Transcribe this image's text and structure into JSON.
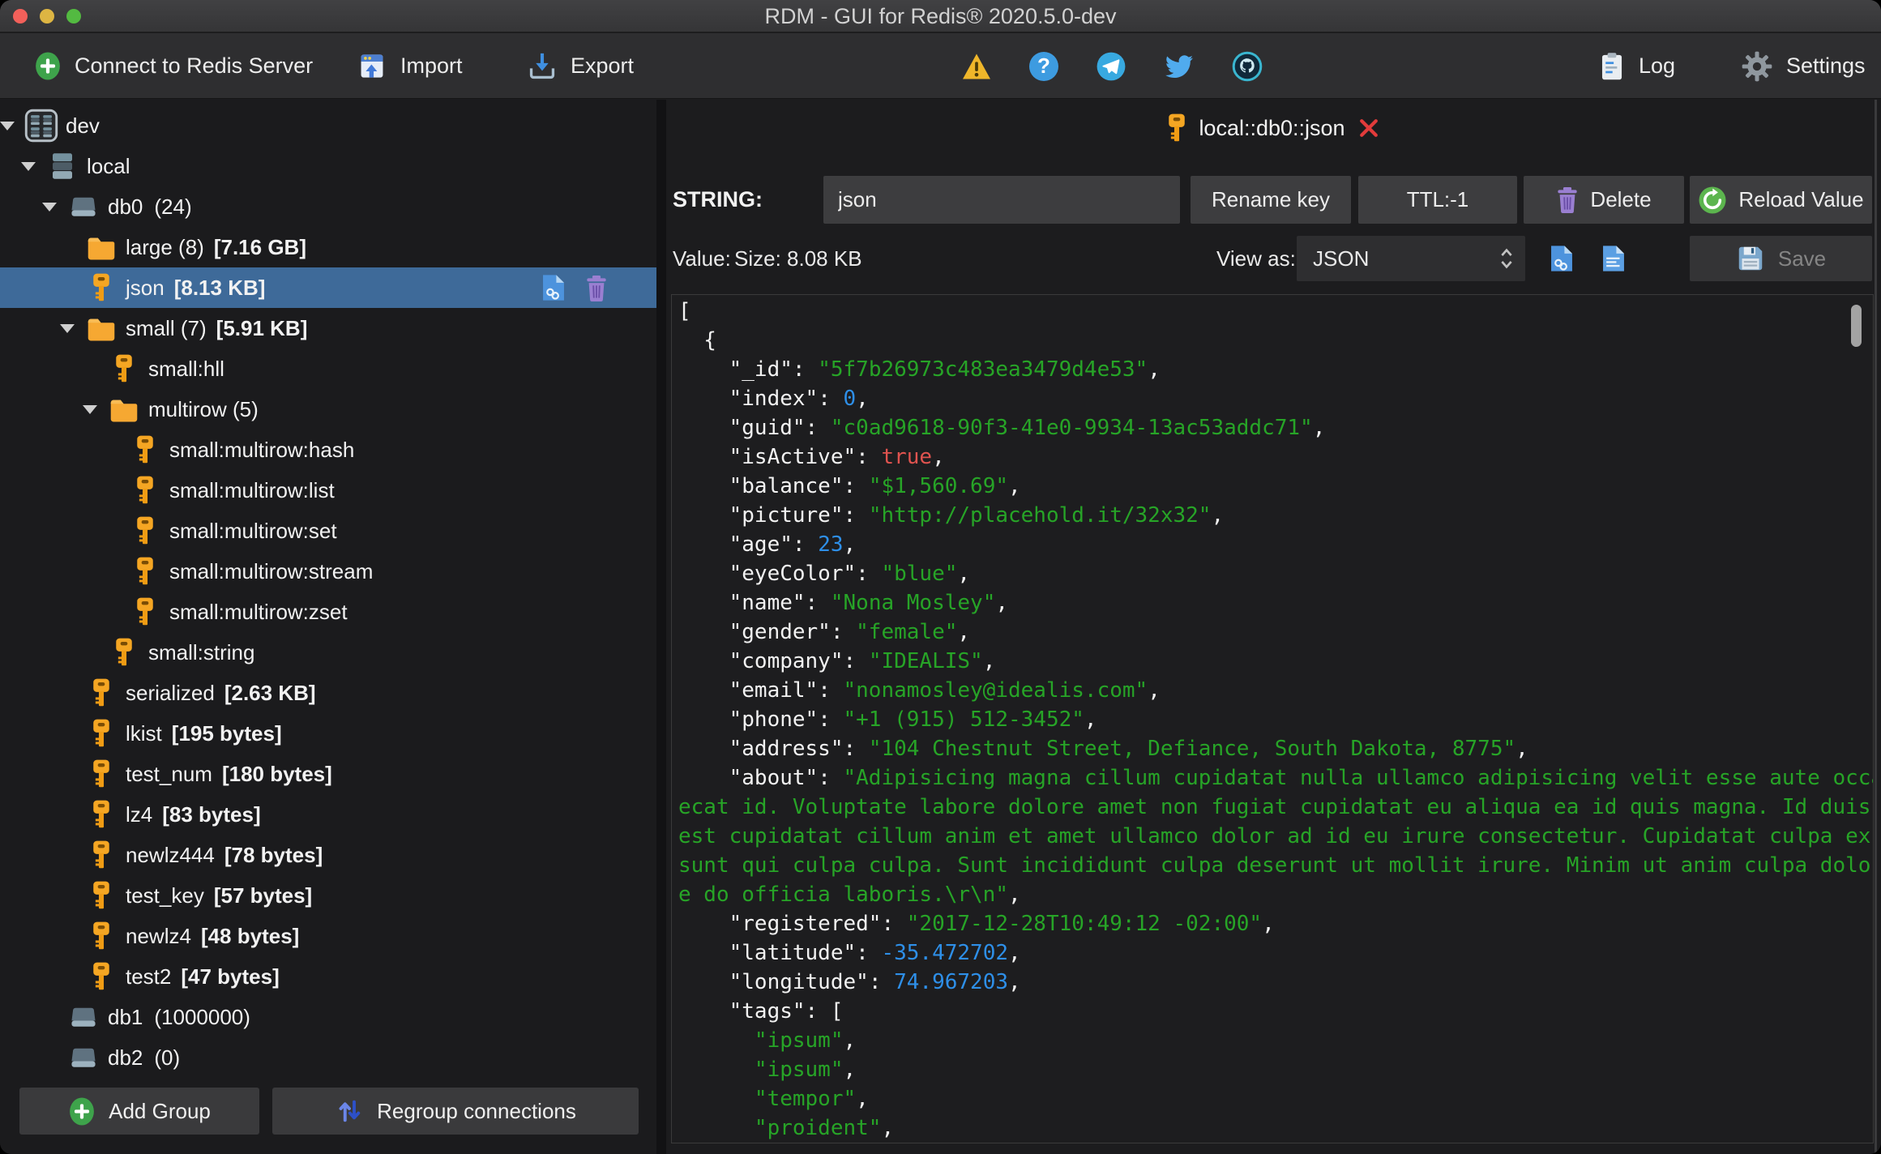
{
  "window": {
    "title": "RDM - GUI for Redis® 2020.5.0-dev"
  },
  "titlebar_buttons": [
    "close",
    "minimize",
    "zoom"
  ],
  "toolbar": {
    "connect_label": "Connect to Redis Server",
    "import_label": "Import",
    "export_label": "Export",
    "status_icons": [
      "warning-icon",
      "help-icon",
      "telegram-icon",
      "twitter-icon",
      "github-icon"
    ],
    "log_label": "Log",
    "settings_label": "Settings"
  },
  "tab": {
    "icon": "key-icon",
    "title": "local::db0::json",
    "close_icon": "close-icon"
  },
  "key_editor": {
    "type_label": "STRING:",
    "key_name": "json",
    "rename_label": "Rename key",
    "ttl_label": "TTL:-1",
    "delete_label": "Delete",
    "reload_label": "Reload Value",
    "value_label": "Value:",
    "size_label": "Size: 8.08 KB",
    "view_as_label": "View as:",
    "view_as_value": "JSON",
    "action_icons": [
      "doc-link",
      "doc-text"
    ],
    "save_label": "Save"
  },
  "sidebar": {
    "tree": [
      {
        "id": "dev",
        "level": 0,
        "arrow": true,
        "icon": "cluster",
        "name": "dev"
      },
      {
        "id": "local",
        "level": 1,
        "arrow": true,
        "icon": "server",
        "name": "local"
      },
      {
        "id": "db0",
        "level": 2,
        "arrow": true,
        "icon": "db",
        "name": "db0",
        "count": "(24)"
      },
      {
        "id": "large",
        "level": 3,
        "icon": "folder",
        "name": "large (8)",
        "size": "[7.16 GB]"
      },
      {
        "id": "json",
        "level": 3,
        "icon": "key",
        "name": "json",
        "size": "[8.13 KB]",
        "selected": true,
        "actions": [
          "doc-link",
          "trash"
        ]
      },
      {
        "id": "small",
        "level": 3,
        "arrow": true,
        "icon": "folder",
        "name": "small (7)",
        "size": "[5.91 KB]"
      },
      {
        "id": "small-hll",
        "level": 4,
        "icon": "key",
        "name": "small:hll"
      },
      {
        "id": "multirow",
        "level": 4,
        "arrow": true,
        "icon": "folder",
        "name": "multirow (5)"
      },
      {
        "id": "small-multirow-hash",
        "level": 5,
        "icon": "key",
        "name": "small:multirow:hash"
      },
      {
        "id": "small-multirow-list",
        "level": 5,
        "icon": "key",
        "name": "small:multirow:list"
      },
      {
        "id": "small-multirow-set",
        "level": 5,
        "icon": "key",
        "name": "small:multirow:set"
      },
      {
        "id": "small-multirow-stream",
        "level": 5,
        "icon": "key",
        "name": "small:multirow:stream"
      },
      {
        "id": "small-multirow-zset",
        "level": 5,
        "icon": "key",
        "name": "small:multirow:zset"
      },
      {
        "id": "small-string",
        "level": 4,
        "icon": "key",
        "name": "small:string"
      },
      {
        "id": "serialized",
        "level": 3,
        "icon": "key",
        "name": "serialized",
        "size": "[2.63 KB]"
      },
      {
        "id": "lkist",
        "level": 3,
        "icon": "key",
        "name": "lkist",
        "size": "[195 bytes]"
      },
      {
        "id": "test_num",
        "level": 3,
        "icon": "key",
        "name": "test_num",
        "size": "[180 bytes]"
      },
      {
        "id": "lz4",
        "level": 3,
        "icon": "key",
        "name": "lz4",
        "size": "[83 bytes]"
      },
      {
        "id": "newlz444",
        "level": 3,
        "icon": "key",
        "name": "newlz444",
        "size": "[78 bytes]"
      },
      {
        "id": "test_key",
        "level": 3,
        "icon": "key",
        "name": "test_key",
        "size": "[57 bytes]"
      },
      {
        "id": "newlz4",
        "level": 3,
        "icon": "key",
        "name": "newlz4",
        "size": "[48 bytes]"
      },
      {
        "id": "test2",
        "level": 3,
        "icon": "key",
        "name": "test2",
        "size": "[47 bytes]"
      },
      {
        "id": "db1",
        "level": 2,
        "icon": "db",
        "name": "db1",
        "count": "(1000000)"
      },
      {
        "id": "db2",
        "level": 2,
        "icon": "db",
        "name": "db2",
        "count": "(0)"
      }
    ],
    "add_group_label": "Add Group",
    "regroup_label": "Regroup connections"
  },
  "editor": {
    "lines": [
      [
        [
          "p",
          "["
        ]
      ],
      [
        [
          "p",
          "  {"
        ]
      ],
      [
        [
          "k",
          "    \"_id\""
        ],
        [
          "p",
          ": "
        ],
        [
          "s",
          "\"5f7b26973c483ea3479d4e53\""
        ],
        [
          "p",
          ","
        ]
      ],
      [
        [
          "k",
          "    \"index\""
        ],
        [
          "p",
          ": "
        ],
        [
          "n",
          "0"
        ],
        [
          "p",
          ","
        ]
      ],
      [
        [
          "k",
          "    \"guid\""
        ],
        [
          "p",
          ": "
        ],
        [
          "s",
          "\"c0ad9618-90f3-41e0-9934-13ac53addc71\""
        ],
        [
          "p",
          ","
        ]
      ],
      [
        [
          "k",
          "    \"isActive\""
        ],
        [
          "p",
          ": "
        ],
        [
          "b",
          "true"
        ],
        [
          "p",
          ","
        ]
      ],
      [
        [
          "k",
          "    \"balance\""
        ],
        [
          "p",
          ": "
        ],
        [
          "s",
          "\"$1,560.69\""
        ],
        [
          "p",
          ","
        ]
      ],
      [
        [
          "k",
          "    \"picture\""
        ],
        [
          "p",
          ": "
        ],
        [
          "s",
          "\"http://placehold.it/32x32\""
        ],
        [
          "p",
          ","
        ]
      ],
      [
        [
          "k",
          "    \"age\""
        ],
        [
          "p",
          ": "
        ],
        [
          "n",
          "23"
        ],
        [
          "p",
          ","
        ]
      ],
      [
        [
          "k",
          "    \"eyeColor\""
        ],
        [
          "p",
          ": "
        ],
        [
          "s",
          "\"blue\""
        ],
        [
          "p",
          ","
        ]
      ],
      [
        [
          "k",
          "    \"name\""
        ],
        [
          "p",
          ": "
        ],
        [
          "s",
          "\"Nona Mosley\""
        ],
        [
          "p",
          ","
        ]
      ],
      [
        [
          "k",
          "    \"gender\""
        ],
        [
          "p",
          ": "
        ],
        [
          "s",
          "\"female\""
        ],
        [
          "p",
          ","
        ]
      ],
      [
        [
          "k",
          "    \"company\""
        ],
        [
          "p",
          ": "
        ],
        [
          "s",
          "\"IDEALIS\""
        ],
        [
          "p",
          ","
        ]
      ],
      [
        [
          "k",
          "    \"email\""
        ],
        [
          "p",
          ": "
        ],
        [
          "s",
          "\"nonamosley@idealis.com\""
        ],
        [
          "p",
          ","
        ]
      ],
      [
        [
          "k",
          "    \"phone\""
        ],
        [
          "p",
          ": "
        ],
        [
          "s",
          "\"+1 (915) 512-3452\""
        ],
        [
          "p",
          ","
        ]
      ],
      [
        [
          "k",
          "    \"address\""
        ],
        [
          "p",
          ": "
        ],
        [
          "s",
          "\"104 Chestnut Street, Defiance, South Dakota, 8775\""
        ],
        [
          "p",
          ","
        ]
      ],
      [
        [
          "k",
          "    \"about\""
        ],
        [
          "p",
          ": "
        ],
        [
          "s",
          "\"Adipisicing magna cillum cupidatat nulla ullamco adipisicing velit esse aute occa"
        ]
      ],
      [
        [
          "s",
          "ecat id. Voluptate labore dolore amet non fugiat cupidatat eu aliqua ea id quis magna. Id duis "
        ]
      ],
      [
        [
          "s",
          "est cupidatat cillum anim et amet ullamco dolor ad id eu irure consectetur. Cupidatat culpa ex "
        ]
      ],
      [
        [
          "s",
          "sunt qui culpa culpa. Sunt incididunt culpa deserunt ut mollit irure. Minim ut anim culpa dolore"
        ]
      ],
      [
        [
          "s",
          "e do officia laboris.\\r\\n\""
        ],
        [
          "p",
          ","
        ]
      ],
      [
        [
          "k",
          "    \"registered\""
        ],
        [
          "p",
          ": "
        ],
        [
          "s",
          "\"2017-12-28T10:49:12 -02:00\""
        ],
        [
          "p",
          ","
        ]
      ],
      [
        [
          "k",
          "    \"latitude\""
        ],
        [
          "p",
          ": "
        ],
        [
          "n",
          "-35.472702"
        ],
        [
          "p",
          ","
        ]
      ],
      [
        [
          "k",
          "    \"longitude\""
        ],
        [
          "p",
          ": "
        ],
        [
          "n",
          "74.967203"
        ],
        [
          "p",
          ","
        ]
      ],
      [
        [
          "k",
          "    \"tags\""
        ],
        [
          "p",
          ": ["
        ]
      ],
      [
        [
          "s",
          "      \"ipsum\""
        ],
        [
          "p",
          ","
        ]
      ],
      [
        [
          "s",
          "      \"ipsum\""
        ],
        [
          "p",
          ","
        ]
      ],
      [
        [
          "s",
          "      \"tempor\""
        ],
        [
          "p",
          ","
        ]
      ],
      [
        [
          "s",
          "      \"proident\""
        ],
        [
          "p",
          ","
        ]
      ]
    ]
  },
  "colors": {
    "selection": "#3e6a99",
    "key-orange": "#f5a623",
    "syntax-key": "#f2f2f2",
    "syntax-string": "#27a427",
    "syntax-number": "#2e8fe8",
    "syntax-bool": "#e0534f",
    "accent-green": "#43a34d",
    "accent-red": "#e23b3b"
  }
}
